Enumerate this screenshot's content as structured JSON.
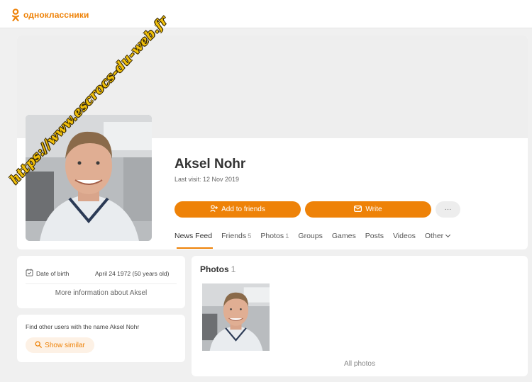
{
  "brand": {
    "logo_text": "одноклассники",
    "accent_color": "#ee8208"
  },
  "profile": {
    "name": "Aksel Nohr",
    "last_visit": "Last visit: 12 Nov 2019",
    "watermark": "https://www.escrocs-du-web.fr"
  },
  "actions": {
    "add_friends_label": "Add to friends",
    "add_friends_icon": "add-user-icon",
    "write_label": "Write",
    "write_icon": "mail-icon",
    "more_label": "···"
  },
  "tabs": [
    {
      "label": "News Feed",
      "count": ""
    },
    {
      "label": "Friends",
      "count": "5"
    },
    {
      "label": "Photos",
      "count": "1"
    },
    {
      "label": "Groups",
      "count": ""
    },
    {
      "label": "Games",
      "count": ""
    },
    {
      "label": "Posts",
      "count": ""
    },
    {
      "label": "Videos",
      "count": ""
    },
    {
      "label": "Other",
      "count": ""
    }
  ],
  "info": {
    "dob_label": "Date of birth",
    "dob_value": "April 24 1972 (50 years old)",
    "dob_icon": "calendar-icon",
    "more_info": "More information about Aksel"
  },
  "find": {
    "text": "Find other users with the name Aksel Nohr",
    "button_label": "Show similar",
    "button_icon": "search-icon"
  },
  "photos": {
    "title": "Photos",
    "count": "1",
    "all_label": "All photos"
  }
}
